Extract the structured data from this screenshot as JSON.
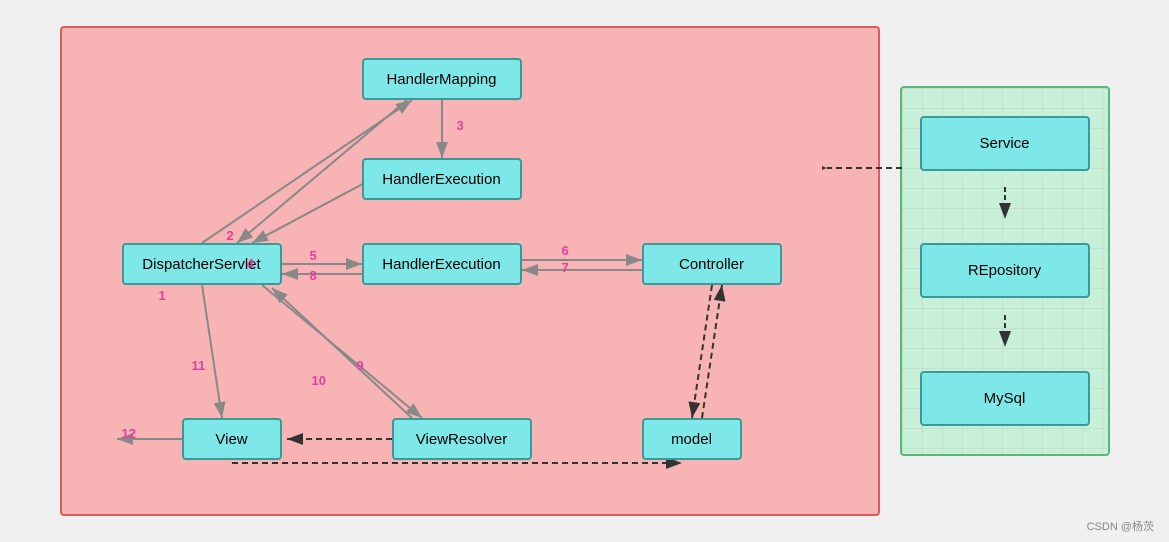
{
  "diagram": {
    "left": {
      "bg_color": "#f8b4b4",
      "border_color": "#e05a5a",
      "boxes": {
        "handler_mapping": "HandlerMapping",
        "handler_execution_top": "HandlerExecution",
        "dispatcher_servlet": "DispatcherServlet",
        "handler_execution_mid": "HandlerExecution",
        "controller": "Controller",
        "view": "View",
        "view_resolver": "ViewResolver",
        "model": "model"
      },
      "numbers": [
        "1",
        "2",
        "3",
        "4",
        "5",
        "6",
        "7",
        "8",
        "9",
        "10",
        "11",
        "12"
      ]
    },
    "right": {
      "bg_color": "#c8f0d8",
      "border_color": "#5ab87a",
      "boxes": {
        "service": "Service",
        "repository": "REpository",
        "mysql": "MySql"
      }
    }
  },
  "watermark": "CSDN @杨茨"
}
